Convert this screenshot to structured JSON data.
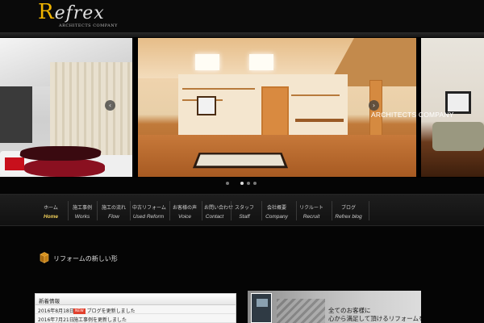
{
  "brand": {
    "logo_first_letter": "R",
    "logo_rest": "efrex",
    "logo_tagline": "ARCHITECTS COMPANY",
    "accent_color": "#f0b400"
  },
  "slider": {
    "caption": "ARCHITECTS COMPANY",
    "prev_icon": "‹",
    "next_icon": "›",
    "slide_count": 4,
    "active_slide": 1
  },
  "nav": {
    "items": [
      {
        "jp": "ホーム",
        "en": "Home",
        "active": true
      },
      {
        "jp": "施工事例",
        "en": "Works",
        "active": false
      },
      {
        "jp": "施工の流れ",
        "en": "Flow",
        "active": false
      },
      {
        "jp": "中古リフォーム",
        "en": "Used Reform",
        "active": false
      },
      {
        "jp": "お客様の声",
        "en": "Voice",
        "active": false
      },
      {
        "jp": "お問い合わせ",
        "en": "Contact",
        "active": false
      },
      {
        "jp": "スタッフ",
        "en": "Staff",
        "active": false
      },
      {
        "jp": "会社概要",
        "en": "Company",
        "active": false
      },
      {
        "jp": "リクルート",
        "en": "Recruit",
        "active": false
      },
      {
        "jp": "ブログ",
        "en": "Refrex blog",
        "active": false
      }
    ]
  },
  "section": {
    "title": "リフォームの新しい形",
    "icon": "box-icon"
  },
  "news": {
    "header": "新着情報",
    "rows": [
      {
        "date": "2016年8月18日",
        "badge": "NEW",
        "text": "ブログを更新しました"
      },
      {
        "date": "2016年7月21日",
        "badge": "",
        "text": "施工事例を更新しました"
      }
    ]
  },
  "banner": {
    "line1": "全てのお客様に",
    "line2": "心から満足して頂けるリフォームを"
  }
}
